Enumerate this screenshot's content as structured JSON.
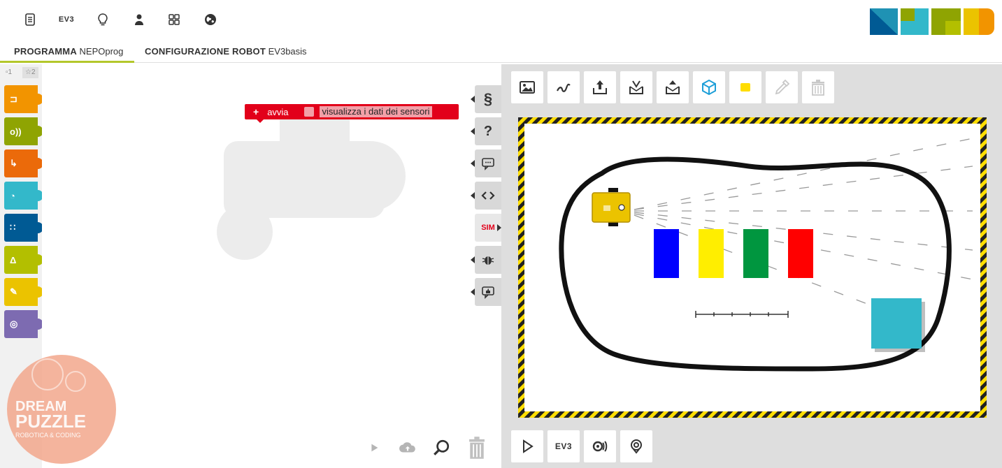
{
  "topbar": {
    "icons": [
      "program-icon",
      "ev3-icon",
      "lightbulb-icon",
      "user-icon",
      "gallery-icon",
      "globe-icon"
    ],
    "ev3_label": "EV3",
    "logo_alt": "NEPO"
  },
  "tabs": {
    "program": {
      "title": "PROGRAMMA",
      "name": "NEPOprog"
    },
    "robot": {
      "title": "CONFIGURAZIONE ROBOT",
      "name": "EV3basis"
    }
  },
  "toolbox": {
    "level1": "1",
    "level2": "2",
    "categories": [
      {
        "name": "action",
        "color": "#f29400"
      },
      {
        "name": "sensors",
        "color": "#8fa402"
      },
      {
        "name": "control",
        "color": "#eb6a0a"
      },
      {
        "name": "logic",
        "color": "#33b8ca"
      },
      {
        "name": "math",
        "color": "#005a94"
      },
      {
        "name": "text",
        "color": "#b3bf00"
      },
      {
        "name": "colour",
        "color": "#ebc300"
      },
      {
        "name": "messages",
        "color": "#7d6bb1"
      }
    ]
  },
  "program": {
    "start_plus": "+",
    "start_label": "avvia",
    "sensor_label": "visualizza i dati dei sensori"
  },
  "sidetabs": {
    "code_symbol": "§",
    "help_symbol": "?",
    "sim_label": "SIM"
  },
  "sim": {
    "toolbar": [
      "image-icon",
      "curve-icon",
      "upload-icon",
      "download-icon",
      "export-icon",
      "cube-icon",
      "yellow-square-icon",
      "pipette-icon",
      "trash-icon"
    ],
    "bottom_ev3_label": "EV3"
  },
  "badge": {
    "line1": "DREAM",
    "line2": "PUZZLE",
    "line3": "ROBOTICA & CODING"
  },
  "colors": {
    "red_block": "#e2001a",
    "blue": "#0000ff",
    "yellow": "#ffee00",
    "green": "#00963f",
    "red": "#ff0000",
    "cyan": "#33b8ca"
  }
}
